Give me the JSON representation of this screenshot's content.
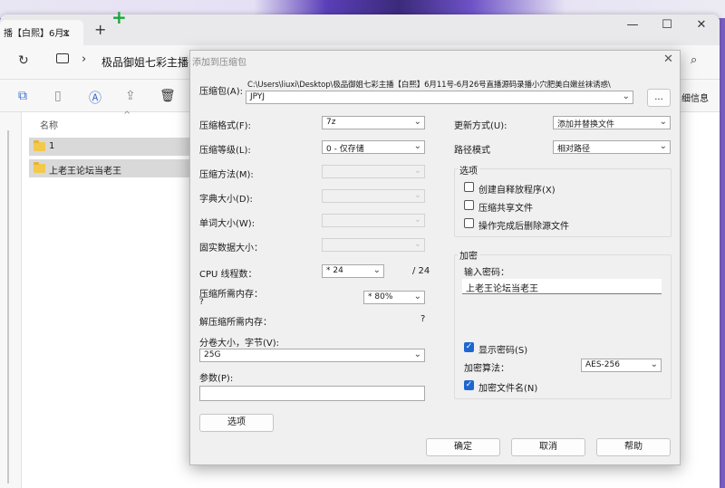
{
  "explorer": {
    "tab_label": "播【白熙】6月1",
    "breadcrumb": "极品御姐七彩主播",
    "toolbar_right_label": "细信息",
    "column_name": "名称",
    "files": [
      "1",
      "上老王论坛当老王"
    ]
  },
  "dialog": {
    "title": "添加到压缩包",
    "archive_label": "压缩包(A):",
    "archive_path": "C:\\Users\\liuxi\\Desktop\\极品御姐七彩主播【白熙】6月11号-6月26号直播源码录播小穴肥美白嫩丝袜诱惑\\",
    "archive_name": "JPYJ",
    "browse_label": "...",
    "left": [
      {
        "label": "压缩格式(F):",
        "value": "7z",
        "disabled": false
      },
      {
        "label": "压缩等级(L):",
        "value": "0 - 仅存储",
        "disabled": false
      },
      {
        "label": "压缩方法(M):",
        "value": "",
        "disabled": true
      },
      {
        "label": "字典大小(D):",
        "value": "",
        "disabled": true
      },
      {
        "label": "单词大小(W):",
        "value": "",
        "disabled": true
      },
      {
        "label": "固实数据大小：",
        "value": "",
        "disabled": true
      }
    ],
    "cpu_label": "CPU 线程数：",
    "cpu_value": "* 24",
    "cpu_total": "/ 24",
    "mem_label": "压缩所需内存：",
    "mem_question": "?",
    "mem_value": "* 80%",
    "decomp_label": "解压缩所需内存：",
    "decomp_value": "?",
    "split_label": "分卷大小，字节(V):",
    "split_value": "25G",
    "params_label": "参数(P):",
    "params_value": "",
    "options_button": "选项",
    "update_label": "更新方式(U):",
    "update_value": "添加并替换文件",
    "pathmode_label": "路径模式",
    "pathmode_value": "相对路径",
    "options_group": "选项",
    "opt_sfx": "创建自释放程序(X)",
    "opt_shared": "压缩共享文件",
    "opt_delete": "操作完成后删除源文件",
    "encrypt_group": "加密",
    "password_label": "输入密码：",
    "password_value": "上老王论坛当老王",
    "show_password": "显示密码(S)",
    "algo_label": "加密算法：",
    "algo_value": "AES-256",
    "encrypt_names": "加密文件名(N)",
    "ok": "确定",
    "cancel": "取消",
    "help": "帮助"
  }
}
